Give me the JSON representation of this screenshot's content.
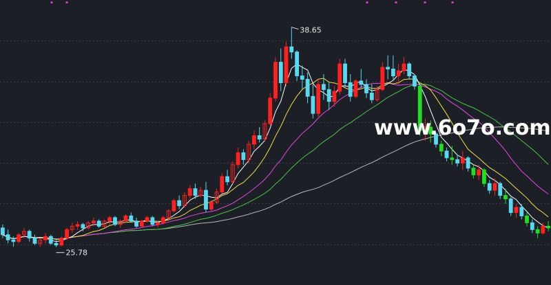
{
  "watermark": "www.6o7o.com",
  "chart_data": {
    "type": "candlestick",
    "ylim": [
      24,
      40
    ],
    "colors": {
      "background": "#1c1f26",
      "grid": "#3a3f4a",
      "up": "#ff2020",
      "down": "#5ad8f0",
      "signal": "#22dd22",
      "ma5": "#ffffff",
      "ma10": "#f5e14a",
      "ma20": "#e04ae0",
      "ma30": "#4cc24c",
      "ma60": "#b8b8b8",
      "marker": "#d23ad2"
    },
    "annotations": {
      "max_label": "38.65",
      "min_label": "25.78"
    },
    "candles": [
      [
        26.9,
        27.1,
        26.3,
        26.5
      ],
      [
        26.5,
        26.8,
        26.0,
        26.2
      ],
      [
        26.2,
        26.4,
        25.8,
        26.1
      ],
      [
        26.1,
        26.6,
        26.0,
        26.5
      ],
      [
        26.5,
        26.9,
        26.3,
        26.7
      ],
      [
        26.7,
        26.8,
        26.1,
        26.3
      ],
      [
        26.3,
        26.5,
        25.9,
        26.0
      ],
      [
        26.0,
        26.3,
        25.8,
        26.2
      ],
      [
        26.2,
        26.6,
        26.0,
        26.4
      ],
      [
        26.4,
        26.5,
        25.9,
        26.0
      ],
      [
        26.0,
        26.2,
        25.78,
        25.9
      ],
      [
        25.9,
        26.4,
        25.8,
        26.3
      ],
      [
        26.3,
        26.9,
        26.2,
        26.8
      ],
      [
        26.8,
        27.2,
        26.6,
        27.0
      ],
      [
        27.0,
        27.3,
        26.8,
        27.1
      ],
      [
        27.1,
        27.2,
        26.7,
        26.9
      ],
      [
        26.9,
        27.3,
        26.8,
        27.2
      ],
      [
        27.2,
        27.5,
        27.0,
        27.3
      ],
      [
        27.3,
        27.4,
        26.9,
        27.0
      ],
      [
        27.0,
        27.4,
        26.9,
        27.3
      ],
      [
        27.3,
        27.6,
        27.1,
        27.5
      ],
      [
        27.5,
        27.6,
        27.0,
        27.1
      ],
      [
        27.1,
        27.4,
        26.9,
        27.3
      ],
      [
        27.3,
        27.7,
        27.2,
        27.6
      ],
      [
        27.6,
        27.8,
        27.2,
        27.3
      ],
      [
        27.3,
        27.5,
        26.9,
        27.0
      ],
      [
        27.0,
        27.4,
        26.9,
        27.3
      ],
      [
        27.3,
        27.6,
        27.2,
        27.5
      ],
      [
        27.5,
        27.6,
        27.0,
        27.1
      ],
      [
        27.1,
        27.3,
        26.9,
        27.2
      ],
      [
        27.2,
        27.6,
        27.1,
        27.5
      ],
      [
        27.5,
        28.0,
        27.4,
        27.9
      ],
      [
        27.9,
        28.6,
        27.8,
        28.5
      ],
      [
        28.5,
        28.8,
        28.0,
        28.2
      ],
      [
        28.2,
        29.0,
        28.1,
        28.8
      ],
      [
        28.8,
        29.4,
        28.6,
        29.2
      ],
      [
        29.2,
        29.5,
        28.6,
        28.8
      ],
      [
        28.8,
        29.3,
        28.7,
        29.1
      ],
      [
        29.1,
        29.6,
        27.8,
        28.0
      ],
      [
        28.0,
        28.5,
        27.9,
        28.4
      ],
      [
        28.4,
        29.2,
        28.3,
        29.0
      ],
      [
        29.0,
        30.1,
        28.9,
        29.9
      ],
      [
        29.9,
        30.3,
        29.4,
        29.6
      ],
      [
        29.6,
        30.8,
        29.5,
        30.6
      ],
      [
        30.6,
        31.6,
        30.4,
        31.3
      ],
      [
        31.3,
        31.5,
        30.6,
        30.9
      ],
      [
        30.9,
        32.0,
        30.7,
        31.8
      ],
      [
        31.8,
        32.6,
        31.5,
        32.3
      ],
      [
        32.3,
        32.8,
        31.9,
        32.1
      ],
      [
        32.1,
        33.2,
        32.0,
        33.0
      ],
      [
        33.0,
        34.8,
        32.9,
        34.5
      ],
      [
        34.5,
        36.9,
        34.3,
        36.6
      ],
      [
        36.6,
        37.4,
        34.9,
        35.4
      ],
      [
        35.4,
        37.8,
        35.2,
        37.5
      ],
      [
        37.5,
        38.65,
        36.8,
        37.2
      ],
      [
        37.2,
        37.3,
        35.5,
        35.8
      ],
      [
        35.8,
        36.4,
        35.0,
        35.6
      ],
      [
        35.6,
        36.0,
        34.2,
        34.6
      ],
      [
        34.6,
        35.3,
        33.3,
        33.6
      ],
      [
        33.6,
        35.6,
        33.4,
        35.3
      ],
      [
        35.3,
        35.9,
        34.4,
        35.0
      ],
      [
        35.0,
        35.4,
        33.8,
        34.3
      ],
      [
        34.3,
        35.2,
        34.0,
        34.9
      ],
      [
        34.9,
        36.8,
        34.7,
        36.5
      ],
      [
        36.5,
        36.8,
        35.1,
        35.4
      ],
      [
        35.4,
        35.9,
        34.3,
        34.6
      ],
      [
        34.6,
        35.6,
        34.5,
        35.5
      ],
      [
        35.5,
        36.2,
        35.1,
        35.3
      ],
      [
        35.3,
        35.6,
        34.5,
        34.8
      ],
      [
        34.8,
        35.3,
        34.2,
        34.4
      ],
      [
        34.4,
        35.2,
        34.3,
        35.0
      ],
      [
        35.0,
        36.6,
        34.9,
        36.3
      ],
      [
        36.3,
        37.0,
        35.6,
        36.2
      ],
      [
        36.2,
        37.0,
        35.6,
        35.8
      ],
      [
        35.8,
        36.5,
        35.3,
        36.1
      ],
      [
        36.1,
        36.9,
        35.9,
        36.5
      ],
      [
        36.5,
        36.6,
        35.6,
        35.8
      ],
      [
        35.8,
        35.9,
        35.0,
        35.2
      ],
      [
        35.2,
        35.4,
        32.3,
        32.6
      ],
      [
        32.6,
        33.3,
        32.0,
        32.8
      ],
      [
        32.8,
        33.2,
        31.9,
        32.4
      ],
      [
        32.4,
        32.5,
        31.6,
        31.8
      ],
      [
        31.8,
        32.0,
        31.1,
        31.4
      ],
      [
        31.4,
        31.6,
        30.8,
        31.0
      ],
      [
        31.0,
        31.7,
        30.6,
        30.9
      ],
      [
        30.9,
        31.2,
        30.5,
        30.7
      ],
      [
        30.7,
        31.4,
        30.3,
        31.0
      ],
      [
        31.0,
        31.1,
        30.2,
        30.4
      ],
      [
        30.4,
        30.6,
        29.8,
        30.0
      ],
      [
        30.0,
        30.6,
        29.7,
        30.3
      ],
      [
        30.3,
        30.4,
        29.3,
        29.5
      ],
      [
        29.5,
        29.7,
        28.9,
        29.1
      ],
      [
        29.1,
        29.8,
        28.8,
        29.5
      ],
      [
        29.5,
        29.6,
        28.6,
        28.8
      ],
      [
        28.8,
        29.2,
        28.3,
        28.6
      ],
      [
        28.6,
        28.7,
        27.6,
        27.8
      ],
      [
        27.8,
        28.3,
        27.5,
        28.1
      ],
      [
        28.1,
        28.3,
        27.4,
        27.6
      ],
      [
        27.6,
        27.8,
        27.0,
        27.2
      ],
      [
        27.2,
        27.4,
        26.6,
        26.8
      ],
      [
        26.8,
        27.0,
        26.3,
        26.6
      ],
      [
        26.6,
        27.2,
        26.5,
        27.0
      ],
      [
        27.0,
        27.3,
        26.7,
        26.9
      ]
    ]
  }
}
